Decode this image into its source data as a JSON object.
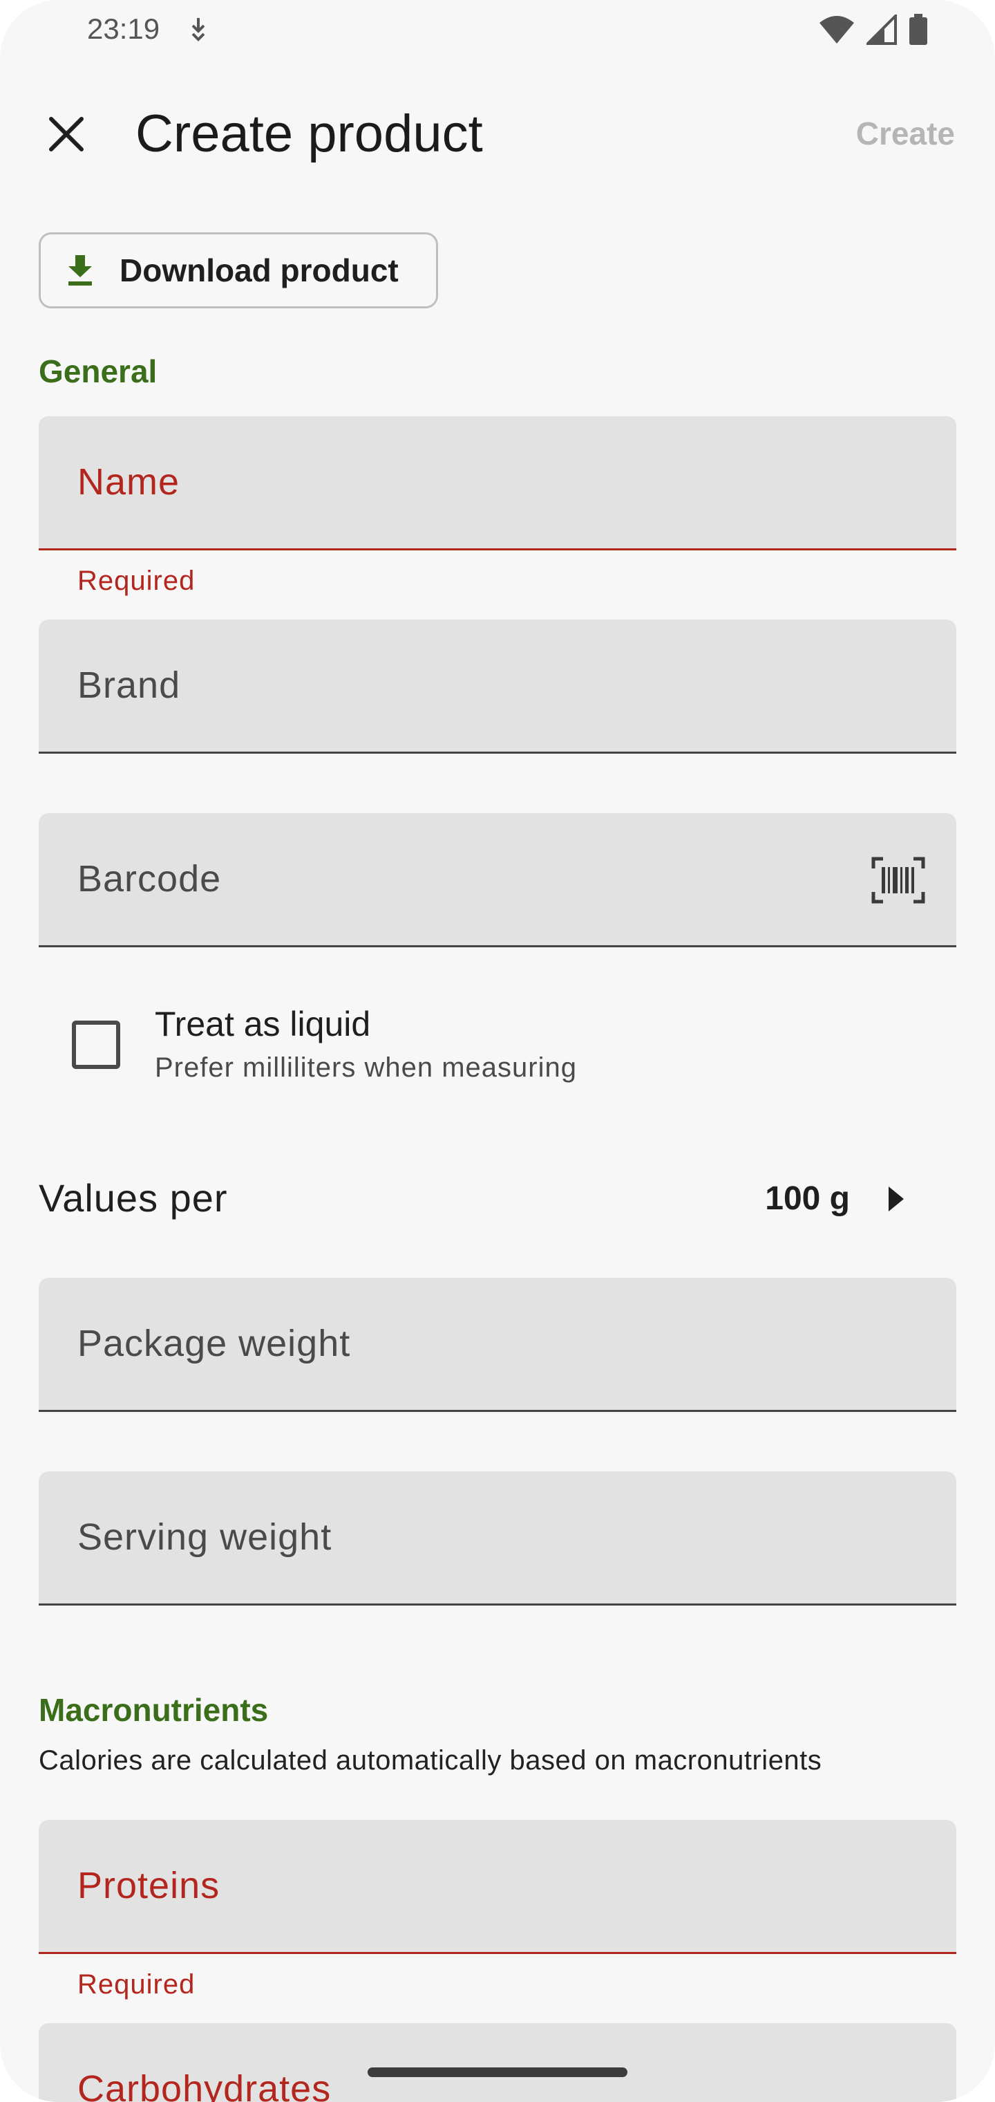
{
  "status_bar": {
    "time": "23:19",
    "icons": [
      "download-icon",
      "wifi-icon",
      "signal-icon",
      "battery-icon"
    ]
  },
  "app_bar": {
    "title": "Create product",
    "action_label": "Create",
    "close_icon": "close-icon"
  },
  "download_button": {
    "label": "Download product",
    "icon": "download-icon"
  },
  "general": {
    "section_title": "General",
    "name": {
      "placeholder": "Name",
      "error": "Required"
    },
    "brand": {
      "placeholder": "Brand"
    },
    "barcode": {
      "placeholder": "Barcode",
      "icon": "barcode-scan-icon"
    }
  },
  "liquid": {
    "title": "Treat as liquid",
    "subtitle": "Prefer milliliters when measuring",
    "checked": false
  },
  "values_per": {
    "label": "Values per",
    "value": "100 g"
  },
  "weights": {
    "package_placeholder": "Package weight",
    "serving_placeholder": "Serving weight"
  },
  "macronutrients": {
    "section_title": "Macronutrients",
    "hint": "Calories are calculated automatically based on macronutrients",
    "proteins": {
      "placeholder": "Proteins",
      "error": "Required"
    },
    "carbohydrates": {
      "placeholder": "Carbohydrates"
    }
  },
  "colors": {
    "accent": "#3b6e1a",
    "error": "#b3261e",
    "field_bg": "#e2e2e2",
    "background": "#f7f7f7"
  }
}
